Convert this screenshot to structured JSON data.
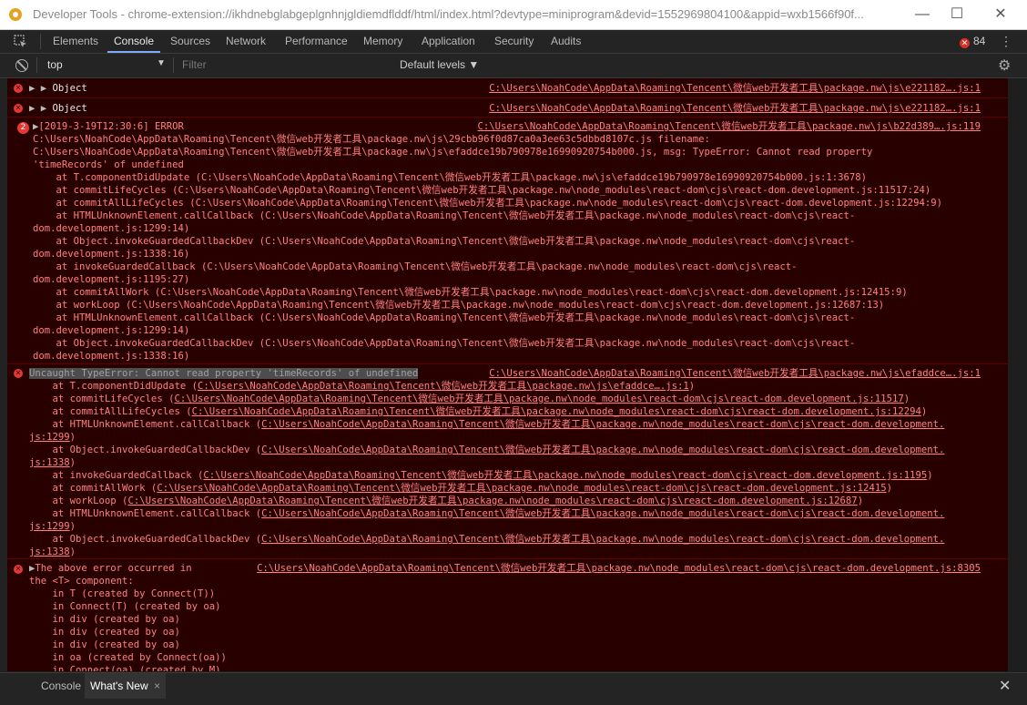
{
  "window": {
    "title": "Developer Tools - chrome-extension://ikhdnebglabgeplgnhnjgldiemdflddf/html/index.html?devtype=miniprogram&devid=1552969804100&appid=wxb1566f90f...",
    "minimize": "—",
    "maximize": "☐",
    "close": "✕"
  },
  "tabs": [
    "Elements",
    "Console",
    "Sources",
    "Network",
    "Performance",
    "Memory",
    "Application",
    "Security",
    "Audits"
  ],
  "error_count": "84",
  "toolbar": {
    "context": "top",
    "filter_placeholder": "Filter",
    "levels": "Default levels ▼"
  },
  "messages": {
    "obj1": {
      "label": "Object",
      "source": "C:\\Users\\NoahCode\\AppData\\Roaming\\Tencent\\微信web开发者工具\\package.nw\\js\\e221182….js:1"
    },
    "obj2": {
      "label": "Object",
      "source": "C:\\Users\\NoahCode\\AppData\\Roaming\\Tencent\\微信web开发者工具\\package.nw\\js\\e221182….js:1"
    },
    "err1": {
      "count": "2",
      "header": "[2019-3-19T12:30:6] ERROR",
      "source": "C:\\Users\\NoahCode\\AppData\\Roaming\\Tencent\\微信web开发者工具\\package.nw\\js\\b22d389….js:119",
      "lines": [
        "C:\\Users\\NoahCode\\AppData\\Roaming\\Tencent\\微信web开发者工具\\package.nw\\js\\29cbb96f0d87ca0a3ee63c5dbbd8107c.js filename:",
        "C:\\Users\\NoahCode\\AppData\\Roaming\\Tencent\\微信web开发者工具\\package.nw\\js\\efaddce19b790978e16990920754b000.js, msg: TypeError: Cannot read property",
        "'timeRecords' of undefined",
        "    at T.componentDidUpdate (C:\\Users\\NoahCode\\AppData\\Roaming\\Tencent\\微信web开发者工具\\package.nw\\js\\efaddce19b790978e16990920754b000.js:1:3678)",
        "    at commitLifeCycles (C:\\Users\\NoahCode\\AppData\\Roaming\\Tencent\\微信web开发者工具\\package.nw\\node_modules\\react-dom\\cjs\\react-dom.development.js:11517:24)",
        "    at commitAllLifeCycles (C:\\Users\\NoahCode\\AppData\\Roaming\\Tencent\\微信web开发者工具\\package.nw\\node_modules\\react-dom\\cjs\\react-dom.development.js:12294:9)",
        "    at HTMLUnknownElement.callCallback (C:\\Users\\NoahCode\\AppData\\Roaming\\Tencent\\微信web开发者工具\\package.nw\\node_modules\\react-dom\\cjs\\react-",
        "dom.development.js:1299:14)",
        "    at Object.invokeGuardedCallbackDev (C:\\Users\\NoahCode\\AppData\\Roaming\\Tencent\\微信web开发者工具\\package.nw\\node_modules\\react-dom\\cjs\\react-",
        "dom.development.js:1338:16)",
        "    at invokeGuardedCallback (C:\\Users\\NoahCode\\AppData\\Roaming\\Tencent\\微信web开发者工具\\package.nw\\node_modules\\react-dom\\cjs\\react-",
        "dom.development.js:1195:27)",
        "    at commitAllWork (C:\\Users\\NoahCode\\AppData\\Roaming\\Tencent\\微信web开发者工具\\package.nw\\node_modules\\react-dom\\cjs\\react-dom.development.js:12415:9)",
        "    at workLoop (C:\\Users\\NoahCode\\AppData\\Roaming\\Tencent\\微信web开发者工具\\package.nw\\node_modules\\react-dom\\cjs\\react-dom.development.js:12687:13)",
        "    at HTMLUnknownElement.callCallback (C:\\Users\\NoahCode\\AppData\\Roaming\\Tencent\\微信web开发者工具\\package.nw\\node_modules\\react-dom\\cjs\\react-",
        "dom.development.js:1299:14)",
        "    at Object.invokeGuardedCallbackDev (C:\\Users\\NoahCode\\AppData\\Roaming\\Tencent\\微信web开发者工具\\package.nw\\node_modules\\react-dom\\cjs\\react-",
        "dom.development.js:1338:16)"
      ]
    },
    "err2": {
      "header": "Uncaught TypeError: Cannot read property 'timeRecords' of undefined",
      "source": "C:\\Users\\NoahCode\\AppData\\Roaming\\Tencent\\微信web开发者工具\\package.nw\\js\\efaddce….js:1",
      "frames": [
        {
          "pre": "    at T.componentDidUpdate (",
          "link": "C:\\Users\\NoahCode\\AppData\\Roaming\\Tencent\\微信web开发者工具\\package.nw\\js\\efaddce….js:1",
          "post": ")"
        },
        {
          "pre": "    at commitLifeCycles (",
          "link": "C:\\Users\\NoahCode\\AppData\\Roaming\\Tencent\\微信web开发者工具\\package.nw\\node_modules\\react-dom\\cjs\\react-dom.development.js:11517",
          "post": ")"
        },
        {
          "pre": "    at commitAllLifeCycles (",
          "link": "C:\\Users\\NoahCode\\AppData\\Roaming\\Tencent\\微信web开发者工具\\package.nw\\node_modules\\react-dom\\cjs\\react-dom.development.js:12294",
          "post": ")"
        },
        {
          "pre": "    at HTMLUnknownElement.callCallback (",
          "link": "C:\\Users\\NoahCode\\AppData\\Roaming\\Tencent\\微信web开发者工具\\package.nw\\node_modules\\react-dom\\cjs\\react-dom.development.",
          "post": ""
        },
        {
          "pre": "",
          "link": "js:1299",
          "post": ")"
        },
        {
          "pre": "    at Object.invokeGuardedCallbackDev (",
          "link": "C:\\Users\\NoahCode\\AppData\\Roaming\\Tencent\\微信web开发者工具\\package.nw\\node_modules\\react-dom\\cjs\\react-dom.development.",
          "post": ""
        },
        {
          "pre": "",
          "link": "js:1338",
          "post": ")"
        },
        {
          "pre": "    at invokeGuardedCallback (",
          "link": "C:\\Users\\NoahCode\\AppData\\Roaming\\Tencent\\微信web开发者工具\\package.nw\\node_modules\\react-dom\\cjs\\react-dom.development.js:1195",
          "post": ")"
        },
        {
          "pre": "    at commitAllWork (",
          "link": "C:\\Users\\NoahCode\\AppData\\Roaming\\Tencent\\微信web开发者工具\\package.nw\\node_modules\\react-dom\\cjs\\react-dom.development.js:12415",
          "post": ")"
        },
        {
          "pre": "    at workLoop (",
          "link": "C:\\Users\\NoahCode\\AppData\\Roaming\\Tencent\\微信web开发者工具\\package.nw\\node_modules\\react-dom\\cjs\\react-dom.development.js:12687",
          "post": ")"
        },
        {
          "pre": "    at HTMLUnknownElement.callCallback (",
          "link": "C:\\Users\\NoahCode\\AppData\\Roaming\\Tencent\\微信web开发者工具\\package.nw\\node_modules\\react-dom\\cjs\\react-dom.development.",
          "post": ""
        },
        {
          "pre": "",
          "link": "js:1299",
          "post": ")"
        },
        {
          "pre": "    at Object.invokeGuardedCallbackDev (",
          "link": "C:\\Users\\NoahCode\\AppData\\Roaming\\Tencent\\微信web开发者工具\\package.nw\\node_modules\\react-dom\\cjs\\react-dom.development.",
          "post": ""
        },
        {
          "pre": "",
          "link": "js:1338",
          "post": ")"
        }
      ]
    },
    "err3": {
      "header": "The above error occurred in",
      "source": "C:\\Users\\NoahCode\\AppData\\Roaming\\Tencent\\微信web开发者工具\\package.nw\\node_modules\\react-dom\\cjs\\react-dom.development.js:8305",
      "lines": [
        "the <T> component:",
        "    in T (created by Connect(T))",
        "    in Connect(T) (created by oa)",
        "    in div (created by oa)",
        "    in div (created by oa)",
        "    in div (created by oa)",
        "    in oa (created by Connect(oa))",
        "    in Connect(oa) (created by M)"
      ]
    }
  },
  "drawer": {
    "tabs": [
      "Console",
      "What's New"
    ],
    "tab_close": "×",
    "close": "✕"
  },
  "colors": {
    "error_bg": "#290000",
    "error_text": "#ff8080",
    "error_border": "#5c0000",
    "accent": "#7cacf8"
  }
}
